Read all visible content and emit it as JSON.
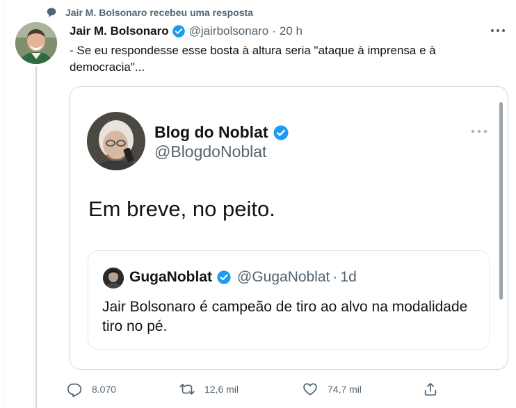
{
  "context": {
    "text": "Jair M. Bolsonaro recebeu uma resposta",
    "icon": "reply-bubble-icon"
  },
  "tweet": {
    "name": "Jair M. Bolsonaro",
    "handle": "@jairbolsonaro",
    "dot": "·",
    "time": "20 h",
    "text": "- Se eu respondesse esse bosta à altura seria \"ataque à imprensa e à democracia\"..."
  },
  "embedded": {
    "name": "Blog do Noblat",
    "handle": "@BlogdoNoblat",
    "text": "Em breve, no peito.",
    "quote": {
      "name": "GugaNoblat",
      "handle": "@GugaNoblat",
      "dot": "·",
      "time": "1d",
      "text": "Jair Bolsonaro é campeão de tiro ao alvo na modalidade tiro no pé."
    }
  },
  "actions": {
    "reply_count": "8.070",
    "retweet_count": "12,6 mil",
    "like_count": "74,7 mil"
  },
  "colors": {
    "verified": "#1d9bf0",
    "secondary_text": "#536471",
    "border": "#cfd9de"
  }
}
